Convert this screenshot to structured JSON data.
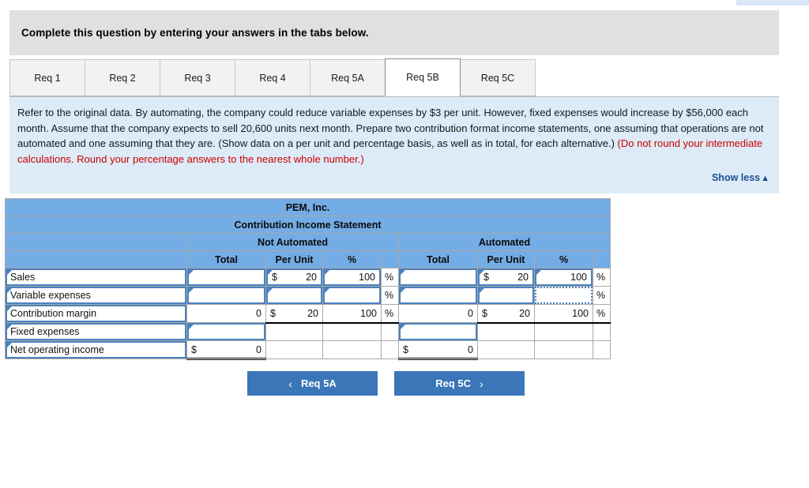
{
  "banner": {
    "instruction": "Complete this question by entering your answers in the tabs below."
  },
  "tabs": [
    {
      "label": "Req 1",
      "active": false
    },
    {
      "label": "Req 2",
      "active": false
    },
    {
      "label": "Req 3",
      "active": false
    },
    {
      "label": "Req 4",
      "active": false
    },
    {
      "label": "Req 5A",
      "active": false
    },
    {
      "label": "Req 5B",
      "active": true
    },
    {
      "label": "Req 5C",
      "active": false
    }
  ],
  "question": {
    "body_part1": "Refer to the original data. By automating, the company could reduce variable expenses by $3 per unit. However, fixed expenses would increase by $56,000 each month. Assume that the company expects to sell 20,600 units next month. Prepare two contribution format income statements, one assuming that operations are not automated and one assuming that they are. (Show data on a per unit and percentage basis, as well as in total, for each alternative.) ",
    "body_red": "(Do not round your intermediate calculations. Round your percentage answers to the nearest whole number.)",
    "show_less_label": "Show less",
    "show_less_caret": "▲"
  },
  "sheet": {
    "company": "PEM, Inc.",
    "statement_title": "Contribution Income Statement",
    "group_not_automated": "Not Automated",
    "group_automated": "Automated",
    "col_total": "Total",
    "col_per_unit": "Per Unit",
    "col_pct": "%",
    "percent_symbol": "%",
    "currency_symbol": "$",
    "rows": [
      {
        "label": "Sales",
        "na_total": "",
        "na_unit_cur": "$",
        "na_unit": "20",
        "na_pct": "100",
        "au_total": "",
        "au_unit_cur": "$",
        "au_unit": "20",
        "au_pct": "100"
      },
      {
        "label": "Variable expenses",
        "na_total": "",
        "na_unit_cur": "",
        "na_unit": "",
        "na_pct": "",
        "au_total": "",
        "au_unit_cur": "",
        "au_unit": "",
        "au_pct": ""
      },
      {
        "label": "Contribution margin",
        "na_total": "0",
        "na_unit_cur": "$",
        "na_unit": "20",
        "na_pct": "100",
        "au_total": "0",
        "au_unit_cur": "$",
        "au_unit": "20",
        "au_pct": "100"
      },
      {
        "label": "Fixed expenses",
        "na_total": "",
        "na_unit_cur": "",
        "na_unit": "",
        "na_pct": "",
        "au_total": "",
        "au_unit_cur": "",
        "au_unit": "",
        "au_pct": ""
      },
      {
        "label": "Net operating income",
        "na_total": "0",
        "na_total_cur": "$",
        "na_unit_cur": "",
        "na_unit": "",
        "na_pct": "",
        "au_total": "0",
        "au_total_cur": "$",
        "au_unit_cur": "",
        "au_unit": "",
        "au_pct": ""
      }
    ]
  },
  "nav": {
    "prev_label": "Req 5A",
    "prev_chevron": "‹",
    "next_label": "Req 5C",
    "next_chevron": "›"
  },
  "colors": {
    "header_blue": "#74ace5",
    "panel_blue": "#dcebf7",
    "button_blue": "#3a76b8",
    "banner_gray": "#e0e0e0",
    "link_blue": "#1d4f91",
    "red_text": "#cc0000",
    "input_border": "#4a82bd"
  }
}
